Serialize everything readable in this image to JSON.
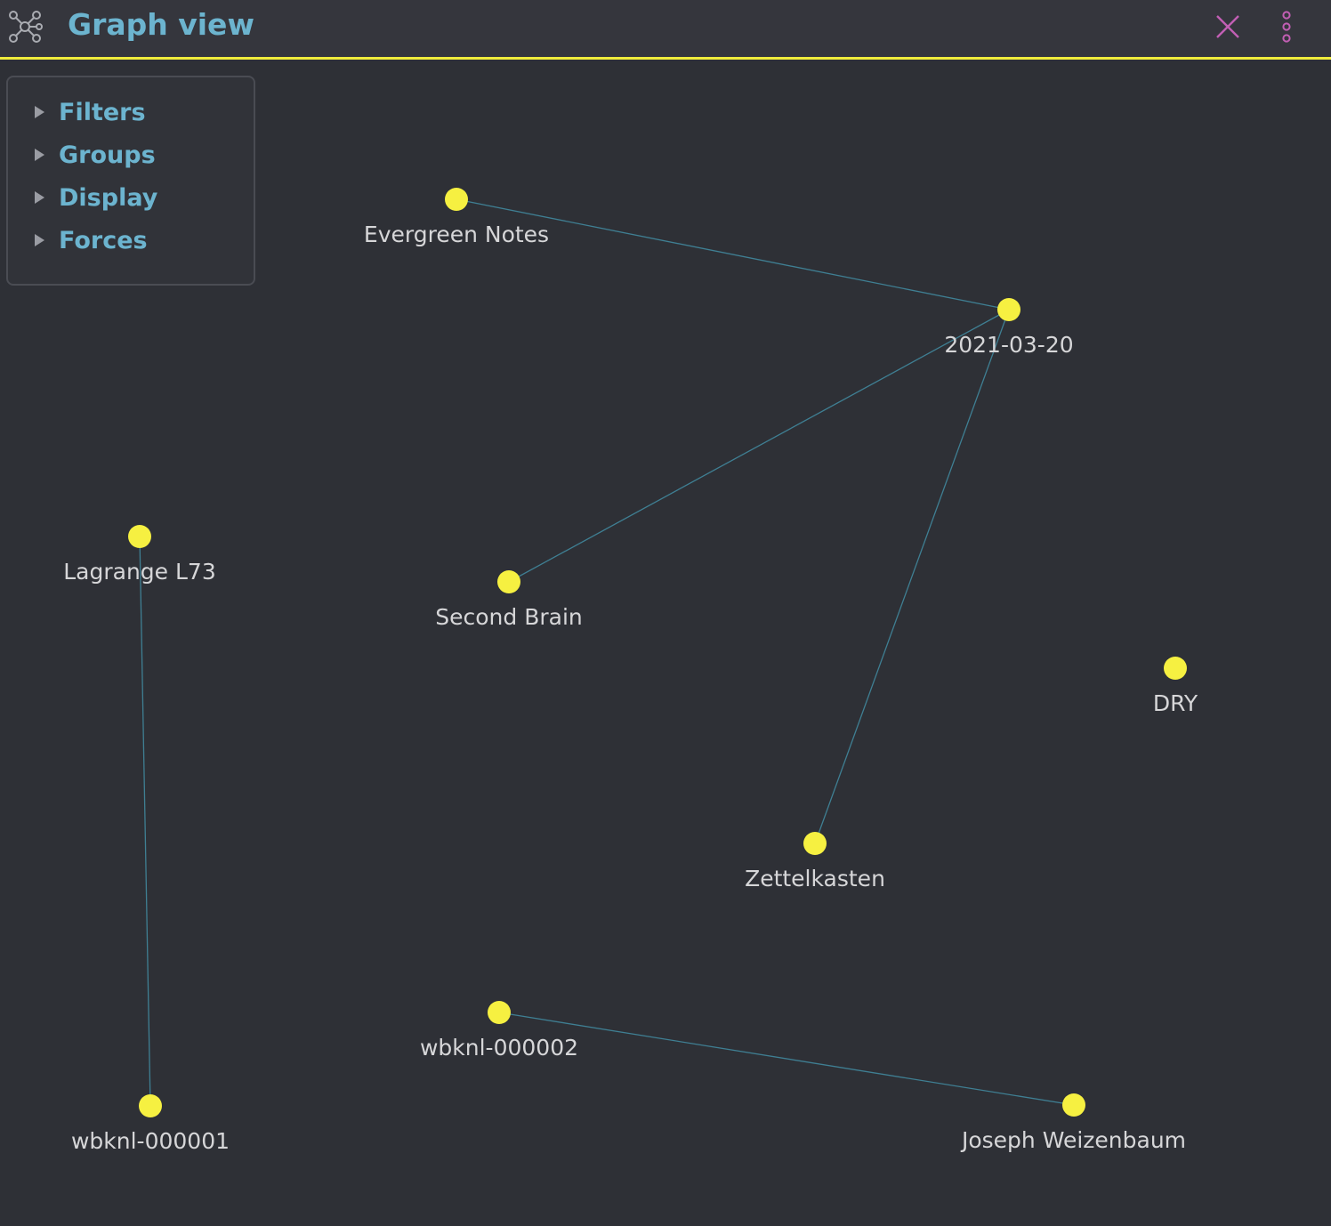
{
  "header": {
    "title": "Graph view",
    "icons": {
      "app": "graph-icon",
      "close": "close-icon",
      "more": "more-vertical-icon"
    }
  },
  "colors": {
    "accent": "#f0ec3c",
    "title": "#6cb4cf",
    "node": "#f6f041",
    "edge": "#3f7f93",
    "close": "#c25fb4",
    "background": "#2e3036"
  },
  "panel": {
    "items": [
      {
        "label": "Filters",
        "expanded": false
      },
      {
        "label": "Groups",
        "expanded": false
      },
      {
        "label": "Display",
        "expanded": false
      },
      {
        "label": "Forces",
        "expanded": false
      }
    ]
  },
  "graph": {
    "nodes": [
      {
        "id": "evergreen",
        "label": "Evergreen Notes"
      },
      {
        "id": "date",
        "label": "2021-03-20"
      },
      {
        "id": "lagrange",
        "label": "Lagrange L73"
      },
      {
        "id": "second",
        "label": "Second Brain"
      },
      {
        "id": "dry",
        "label": "DRY"
      },
      {
        "id": "zettel",
        "label": "Zettelkasten"
      },
      {
        "id": "wb2",
        "label": "wbknl-000002"
      },
      {
        "id": "wb1",
        "label": "wbknl-000001"
      },
      {
        "id": "joseph",
        "label": "Joseph Weizenbaum"
      }
    ],
    "edges": [
      [
        "evergreen",
        "date"
      ],
      [
        "date",
        "second"
      ],
      [
        "date",
        "zettel"
      ],
      [
        "lagrange",
        "wb1"
      ],
      [
        "wb2",
        "joseph"
      ]
    ]
  }
}
